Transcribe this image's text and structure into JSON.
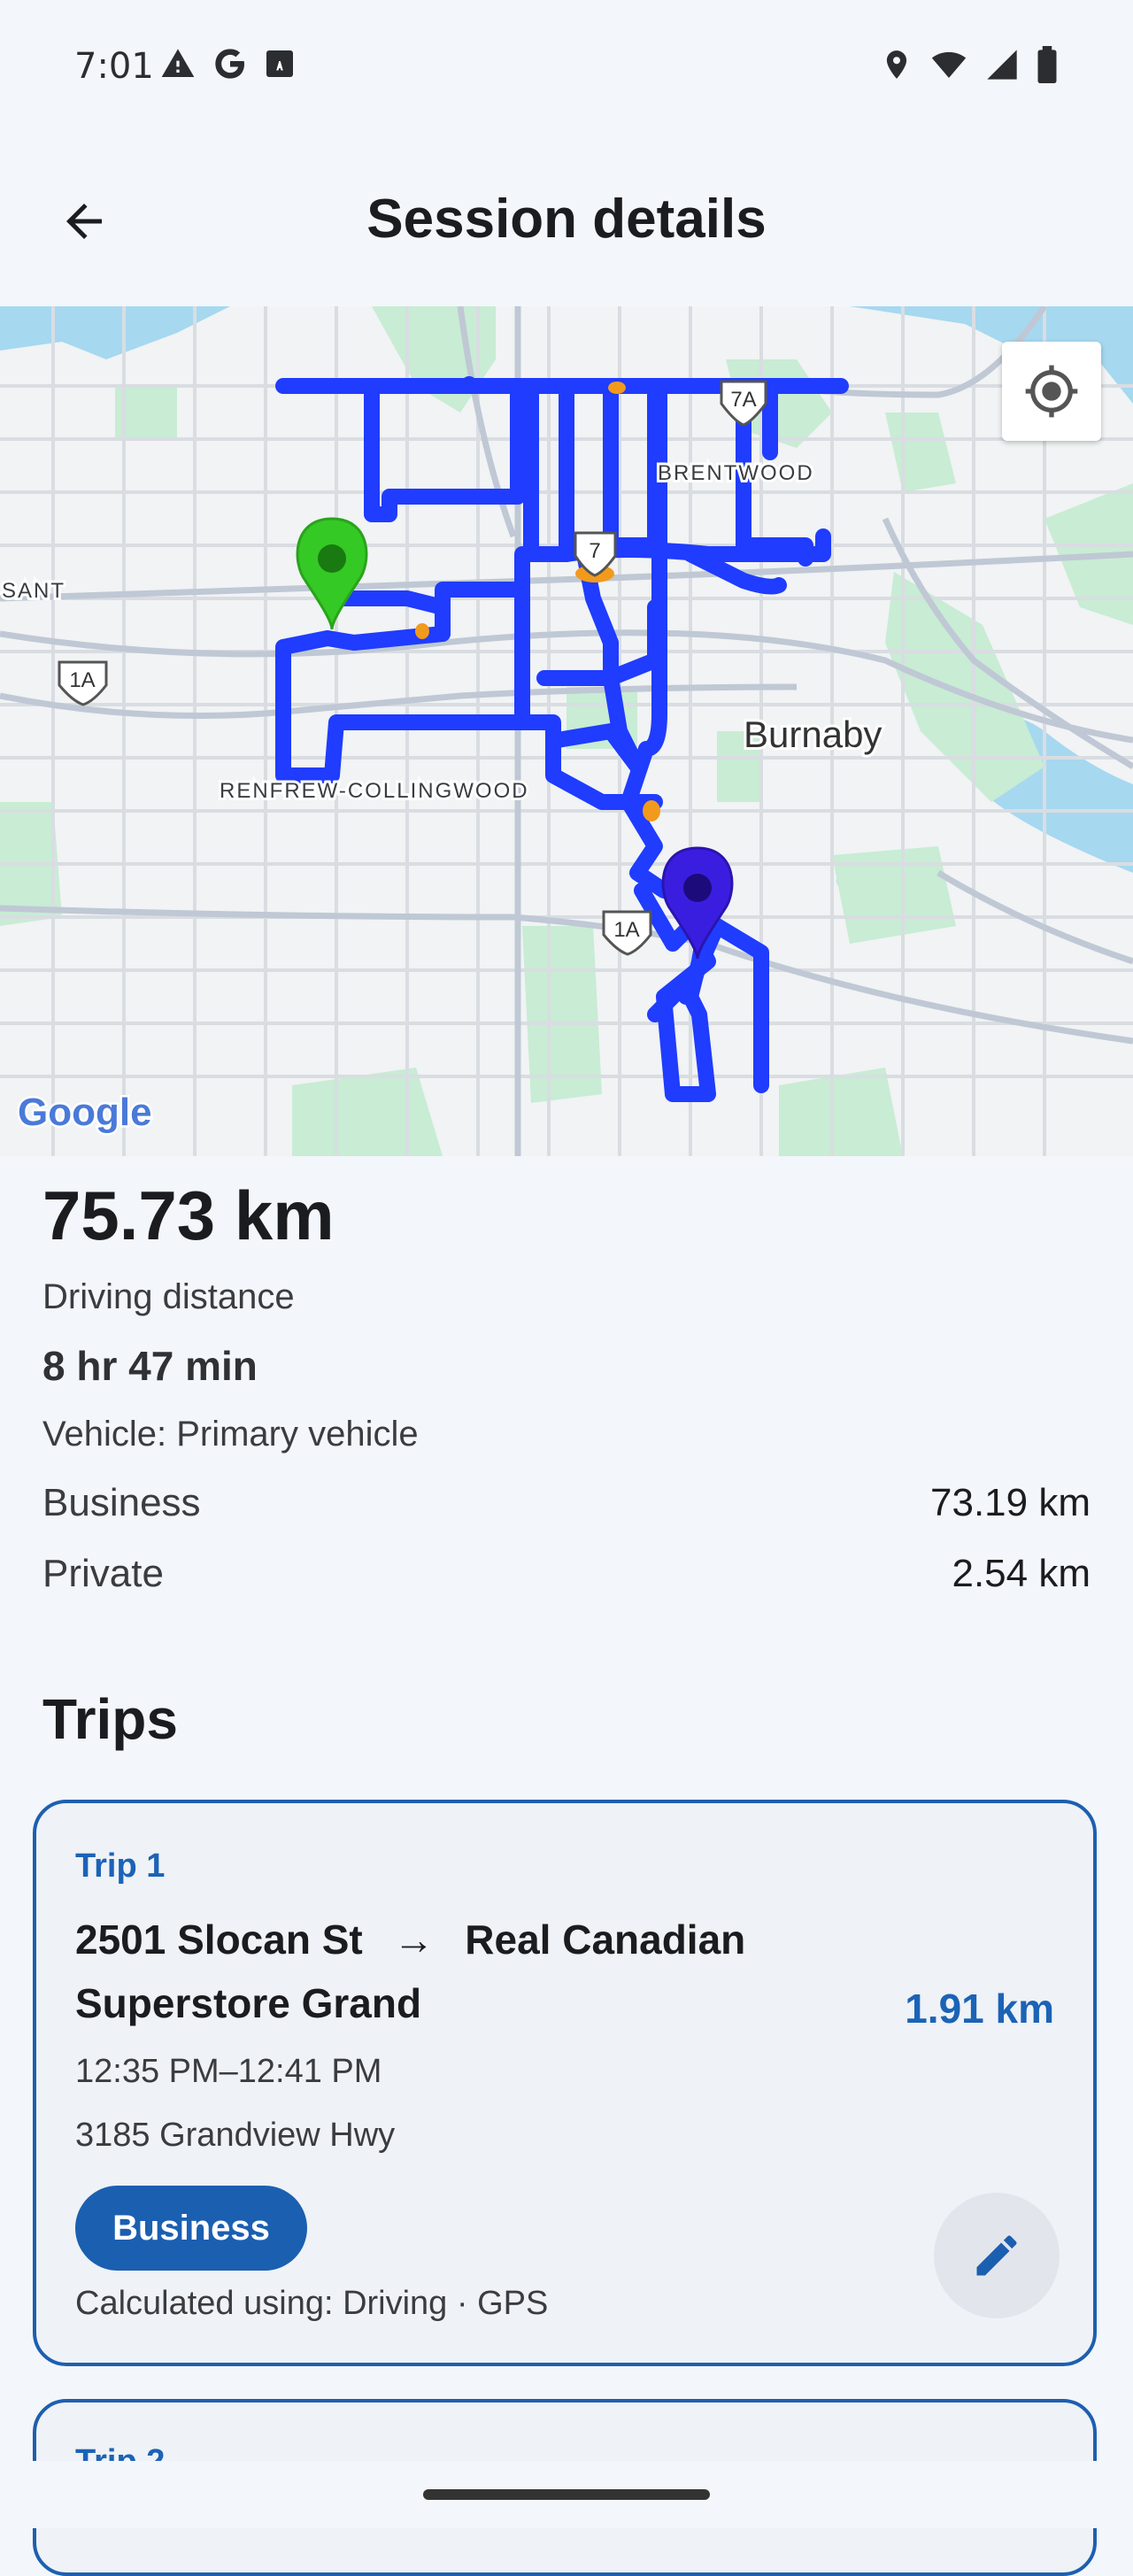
{
  "status_bar": {
    "time": "7:01",
    "left_icons": [
      "warning-icon",
      "google-icon",
      "font-icon"
    ],
    "right_icons": [
      "location-icon",
      "wifi-icon",
      "signal-icon",
      "battery-icon"
    ]
  },
  "app_bar": {
    "title": "Session details",
    "back_icon": "arrow-back-icon"
  },
  "map": {
    "labels": {
      "brentwood": "BRENTWOOD",
      "burnaby": "Burnaby",
      "renfrew": "RENFREW-COLLINGWOOD",
      "sant": "SANT",
      "hwy_7a": "7A",
      "hwy_7": "7",
      "hwy_1a_left": "1A",
      "hwy_1a_bottom": "1A"
    },
    "attribution": "Google",
    "colors": {
      "route": "#1f3cff",
      "start_pin": "#34c924",
      "end_pin": "#3a1ee0",
      "water": "#a6d8f0",
      "park": "#c8ecd4"
    }
  },
  "summary": {
    "distance": "75.73 km",
    "distance_label": "Driving distance",
    "duration": "8 hr 47 min",
    "vehicle": "Vehicle: Primary vehicle",
    "business_label": "Business",
    "business_value": "73.19 km",
    "private_label": "Private",
    "private_value": "2.54 km"
  },
  "trips": {
    "heading": "Trips",
    "items": [
      {
        "label": "Trip 1",
        "from": "2501 Slocan St",
        "arrow": "→",
        "to_line1": "Real Canadian",
        "to_line2": "Superstore Grand",
        "distance": "1.91 km",
        "time": "12:35 PM–12:41 PM",
        "address": "3185 Grandview Hwy",
        "category": "Business",
        "calc": "Calculated using: Driving · GPS"
      },
      {
        "label": "Trip 2"
      }
    ]
  }
}
